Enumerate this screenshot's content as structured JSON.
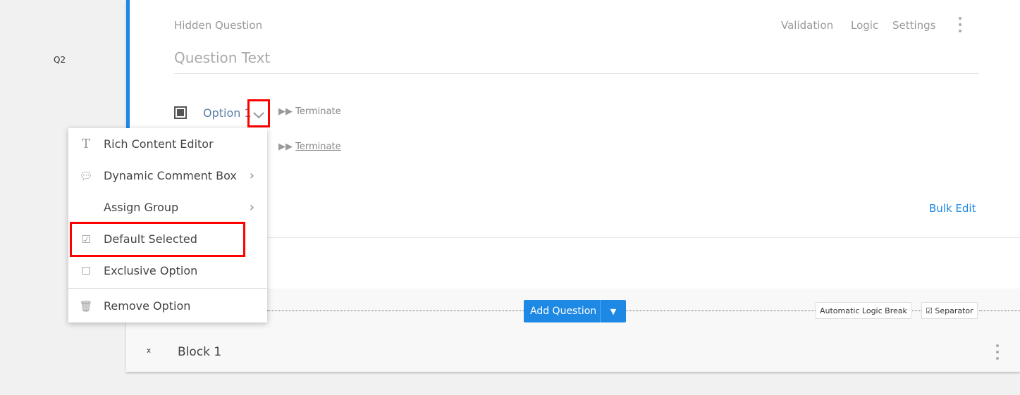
{
  "sidebar": {
    "question_number": "Q2"
  },
  "question": {
    "type_label": "Hidden Question",
    "text_placeholder": "Question Text",
    "toolbar": {
      "validation": "Validation",
      "logic": "Logic",
      "settings": "Settings"
    },
    "options": [
      {
        "label": "Option 1",
        "logic": "Terminate"
      },
      {
        "label": "",
        "logic": "Terminate"
      }
    ],
    "bulk_edit": "Bulk Edit"
  },
  "context_menu": {
    "items": [
      {
        "label": "Rich Content Editor",
        "icon": "text-format-icon"
      },
      {
        "label": "Dynamic Comment Box",
        "icon": "comment-icon"
      },
      {
        "label": "Assign Group",
        "icon": ""
      },
      {
        "label": "Default Selected",
        "icon": "checked-checkbox-icon"
      },
      {
        "label": "Exclusive Option",
        "icon": "checkbox-icon"
      },
      {
        "label": "Remove Option",
        "icon": "trash-icon"
      }
    ]
  },
  "separator_bar": {
    "add_question": "Add Question",
    "automatic_logic_break": "Automatic Logic Break",
    "separator": "Separator"
  },
  "block": {
    "title": "Block 1"
  },
  "colors": {
    "accent": "#1e88e5",
    "highlight": "#ff0000"
  }
}
